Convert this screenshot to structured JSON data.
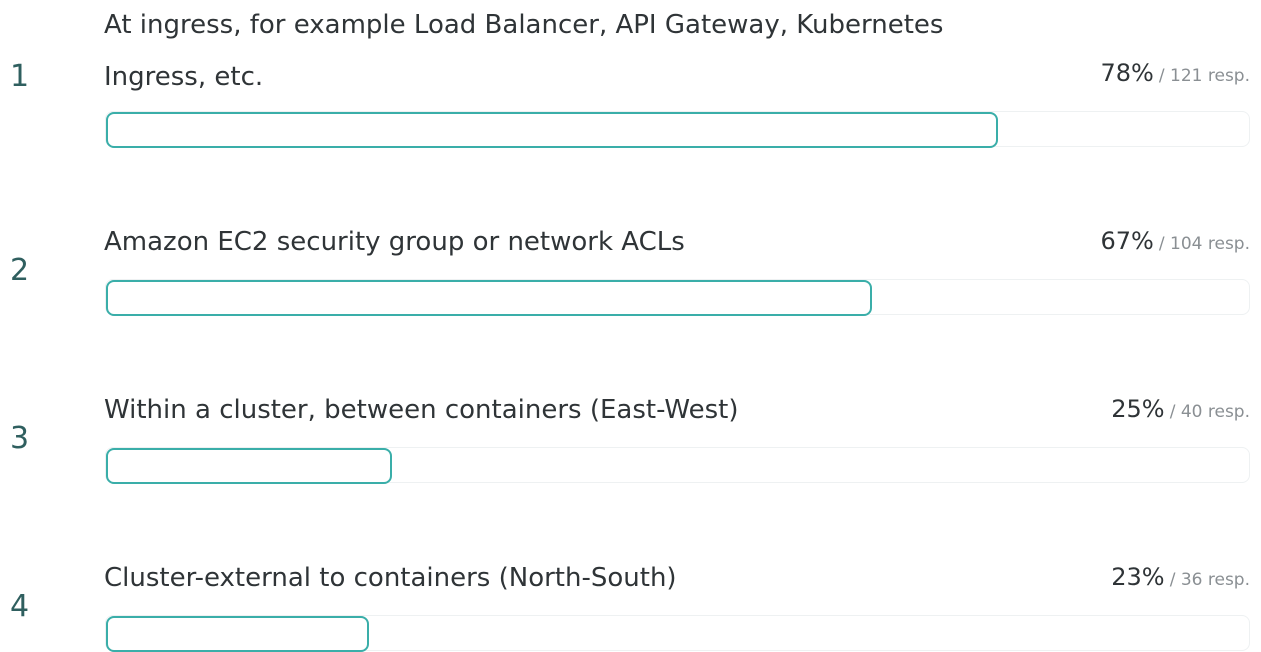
{
  "items": [
    {
      "rank": "1",
      "label": "At ingress, for example Load Balancer, API Gateway, Kubernetes Ingress, etc.",
      "percent": "78%",
      "responses": "/ 121 resp.",
      "fraction": 0.78
    },
    {
      "rank": "2",
      "label": "Amazon EC2 security group or network ACLs",
      "percent": "67%",
      "responses": "/ 104 resp.",
      "fraction": 0.67
    },
    {
      "rank": "3",
      "label": "Within a cluster, between containers (East-West)",
      "percent": "25%",
      "responses": "/ 40 resp.",
      "fraction": 0.25
    },
    {
      "rank": "4",
      "label": "Cluster-external to containers (North-South)",
      "percent": "23%",
      "responses": "/ 36 resp.",
      "fraction": 0.23
    }
  ],
  "colors": {
    "bar_border": "#3aaea9",
    "track_border": "#eef1f2",
    "rank_text": "#2f5f5f",
    "response_text": "#8a8f93"
  }
}
